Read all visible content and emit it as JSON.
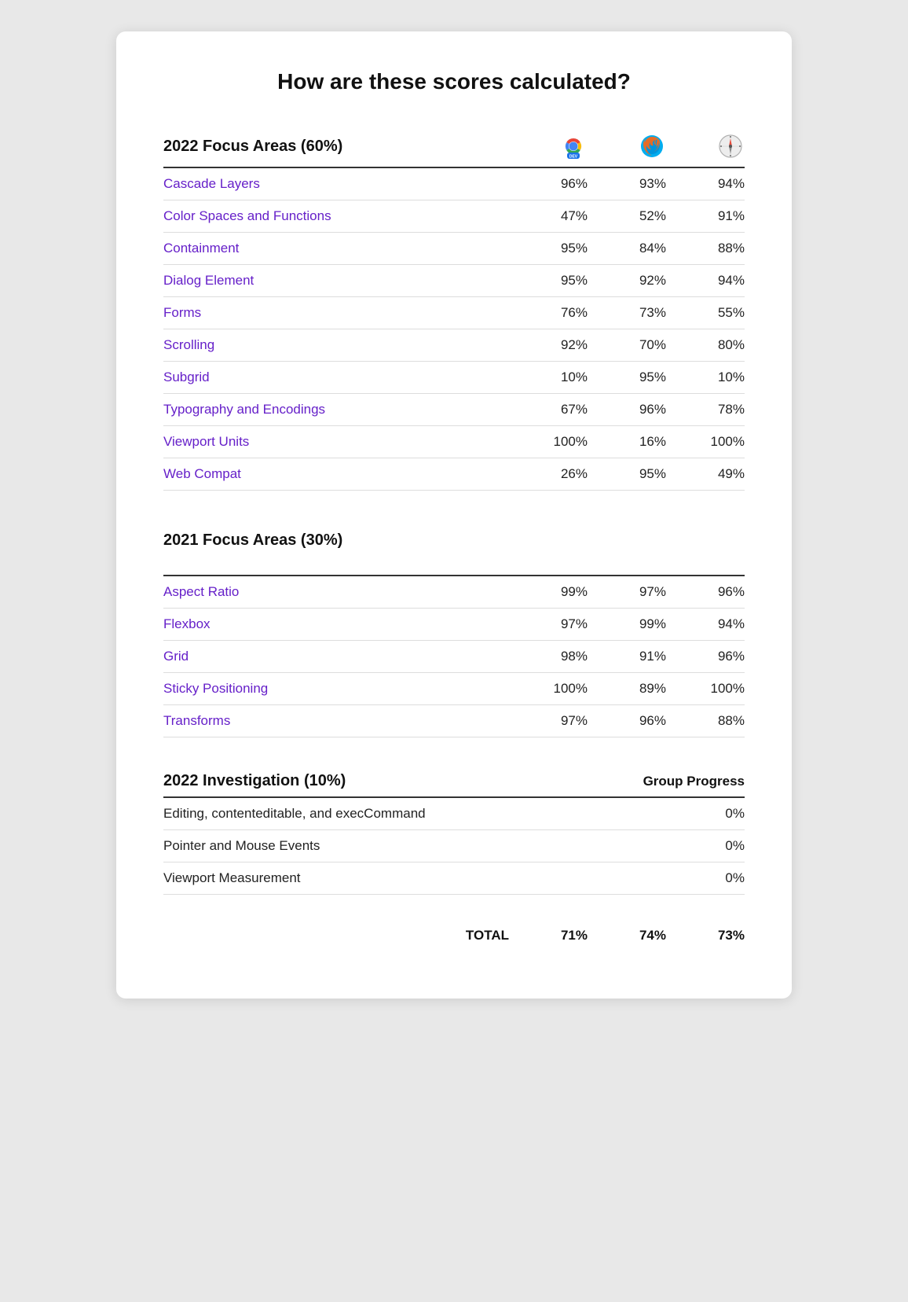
{
  "title": "How are these scores calculated?",
  "sections": {
    "focus2022": {
      "label": "2022 Focus Areas (60%)",
      "browsers": [
        "chrome",
        "firefox",
        "safari"
      ],
      "rows": [
        {
          "name": "Cascade Layers",
          "values": [
            "96%",
            "93%",
            "94%"
          ],
          "linked": true
        },
        {
          "name": "Color Spaces and Functions",
          "values": [
            "47%",
            "52%",
            "91%"
          ],
          "linked": true
        },
        {
          "name": "Containment",
          "values": [
            "95%",
            "84%",
            "88%"
          ],
          "linked": true
        },
        {
          "name": "Dialog Element",
          "values": [
            "95%",
            "92%",
            "94%"
          ],
          "linked": true
        },
        {
          "name": "Forms",
          "values": [
            "76%",
            "73%",
            "55%"
          ],
          "linked": true
        },
        {
          "name": "Scrolling",
          "values": [
            "92%",
            "70%",
            "80%"
          ],
          "linked": true
        },
        {
          "name": "Subgrid",
          "values": [
            "10%",
            "95%",
            "10%"
          ],
          "linked": true
        },
        {
          "name": "Typography and Encodings",
          "values": [
            "67%",
            "96%",
            "78%"
          ],
          "linked": true
        },
        {
          "name": "Viewport Units",
          "values": [
            "100%",
            "16%",
            "100%"
          ],
          "linked": true
        },
        {
          "name": "Web Compat",
          "values": [
            "26%",
            "95%",
            "49%"
          ],
          "linked": true
        }
      ]
    },
    "focus2021": {
      "label": "2021 Focus Areas (30%)",
      "rows": [
        {
          "name": "Aspect Ratio",
          "values": [
            "99%",
            "97%",
            "96%"
          ],
          "linked": true
        },
        {
          "name": "Flexbox",
          "values": [
            "97%",
            "99%",
            "94%"
          ],
          "linked": true
        },
        {
          "name": "Grid",
          "values": [
            "98%",
            "91%",
            "96%"
          ],
          "linked": true
        },
        {
          "name": "Sticky Positioning",
          "values": [
            "100%",
            "89%",
            "100%"
          ],
          "linked": true
        },
        {
          "name": "Transforms",
          "values": [
            "97%",
            "96%",
            "88%"
          ],
          "linked": true
        }
      ]
    },
    "investigation2022": {
      "label": "2022 Investigation (10%)",
      "group_progress_label": "Group Progress",
      "rows": [
        {
          "name": "Editing, contenteditable, and execCommand",
          "value": "0%",
          "linked": false
        },
        {
          "name": "Pointer and Mouse Events",
          "value": "0%",
          "linked": false
        },
        {
          "name": "Viewport Measurement",
          "value": "0%",
          "linked": false
        }
      ]
    },
    "total": {
      "label": "TOTAL",
      "values": [
        "71%",
        "74%",
        "73%"
      ]
    }
  }
}
